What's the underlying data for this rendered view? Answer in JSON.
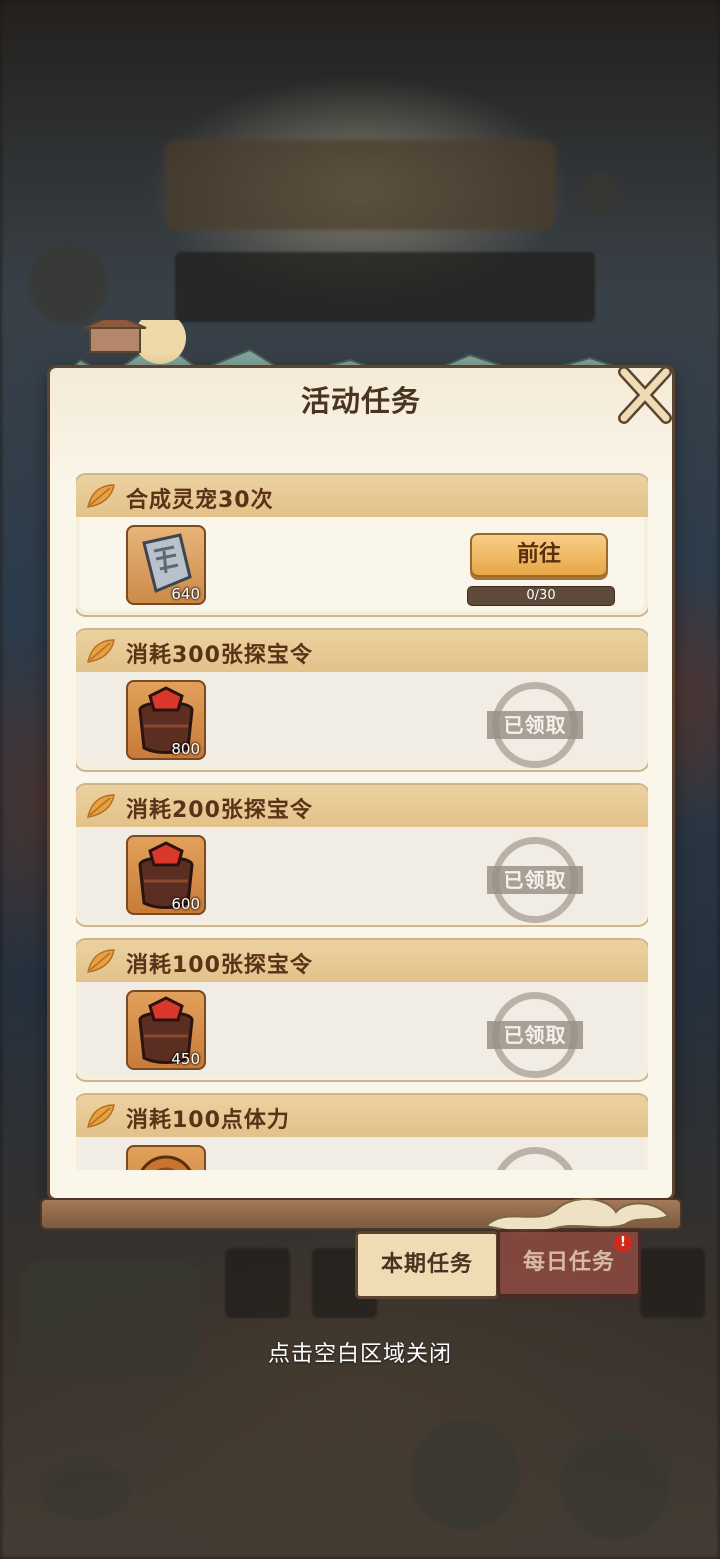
{
  "modal": {
    "title": "活动任务",
    "tasks": [
      {
        "title": "合成灵宠30次",
        "reward_icon": "puzzle-crystal-icon",
        "reward_qty": "640",
        "status": "goto",
        "button_label": "前往",
        "progress_text": "0/30",
        "progress": 0
      },
      {
        "title": "消耗300张探宝令",
        "reward_icon": "treasure-pot-icon",
        "reward_qty": "800",
        "status": "claimed",
        "stamp_label": "已领取"
      },
      {
        "title": "消耗200张探宝令",
        "reward_icon": "treasure-pot-icon",
        "reward_qty": "600",
        "status": "claimed",
        "stamp_label": "已领取"
      },
      {
        "title": "消耗100张探宝令",
        "reward_icon": "treasure-pot-icon",
        "reward_qty": "450",
        "status": "claimed",
        "stamp_label": "已领取"
      },
      {
        "title": "消耗100点体力",
        "reward_icon": "mooncake-icon",
        "status": "claimed"
      }
    ]
  },
  "tabs": [
    {
      "label": "本期任务",
      "active": true
    },
    {
      "label": "每日任务",
      "active": false,
      "badge": "!"
    }
  ],
  "hint": "点击空白区域关闭",
  "colors": {
    "panel": "#fbf6ea",
    "header": "#e3c28a",
    "button": "#e6a543",
    "tab_inactive": "#8a4a40"
  }
}
